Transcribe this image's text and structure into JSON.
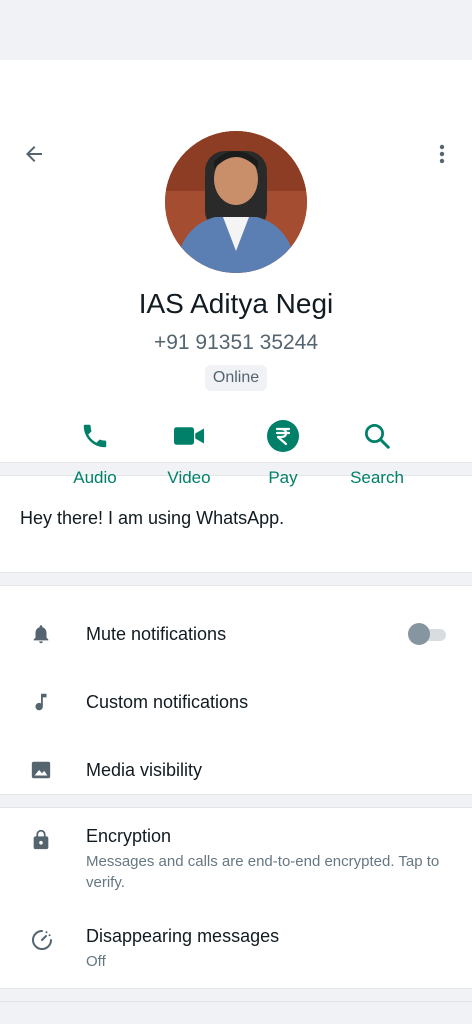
{
  "contact": {
    "name": "IAS Aditya Negi",
    "phone": "+91 91351 35244",
    "status": "Online"
  },
  "actions": [
    {
      "label": "Audio",
      "icon": "phone-icon"
    },
    {
      "label": "Video",
      "icon": "video-icon"
    },
    {
      "label": "Pay",
      "icon": "rupee-icon"
    },
    {
      "label": "Search",
      "icon": "search-icon"
    }
  ],
  "about": "Hey there! I am using WhatsApp.",
  "notifications": {
    "mute": {
      "label": "Mute notifications",
      "icon": "bell-icon",
      "enabled": false
    },
    "custom": {
      "label": "Custom notifications",
      "icon": "music-note-icon"
    },
    "media": {
      "label": "Media visibility",
      "icon": "image-icon"
    }
  },
  "privacy": {
    "encryption": {
      "label": "Encryption",
      "sub": "Messages and calls are end-to-end encrypted. Tap to verify.",
      "icon": "lock-icon"
    },
    "disappearing": {
      "label": "Disappearing messages",
      "sub": "Off",
      "icon": "timer-icon"
    }
  },
  "colors": {
    "accent": "#008069",
    "background": "#f0f2f5",
    "text": "#111b21",
    "secondary": "#54656f"
  }
}
